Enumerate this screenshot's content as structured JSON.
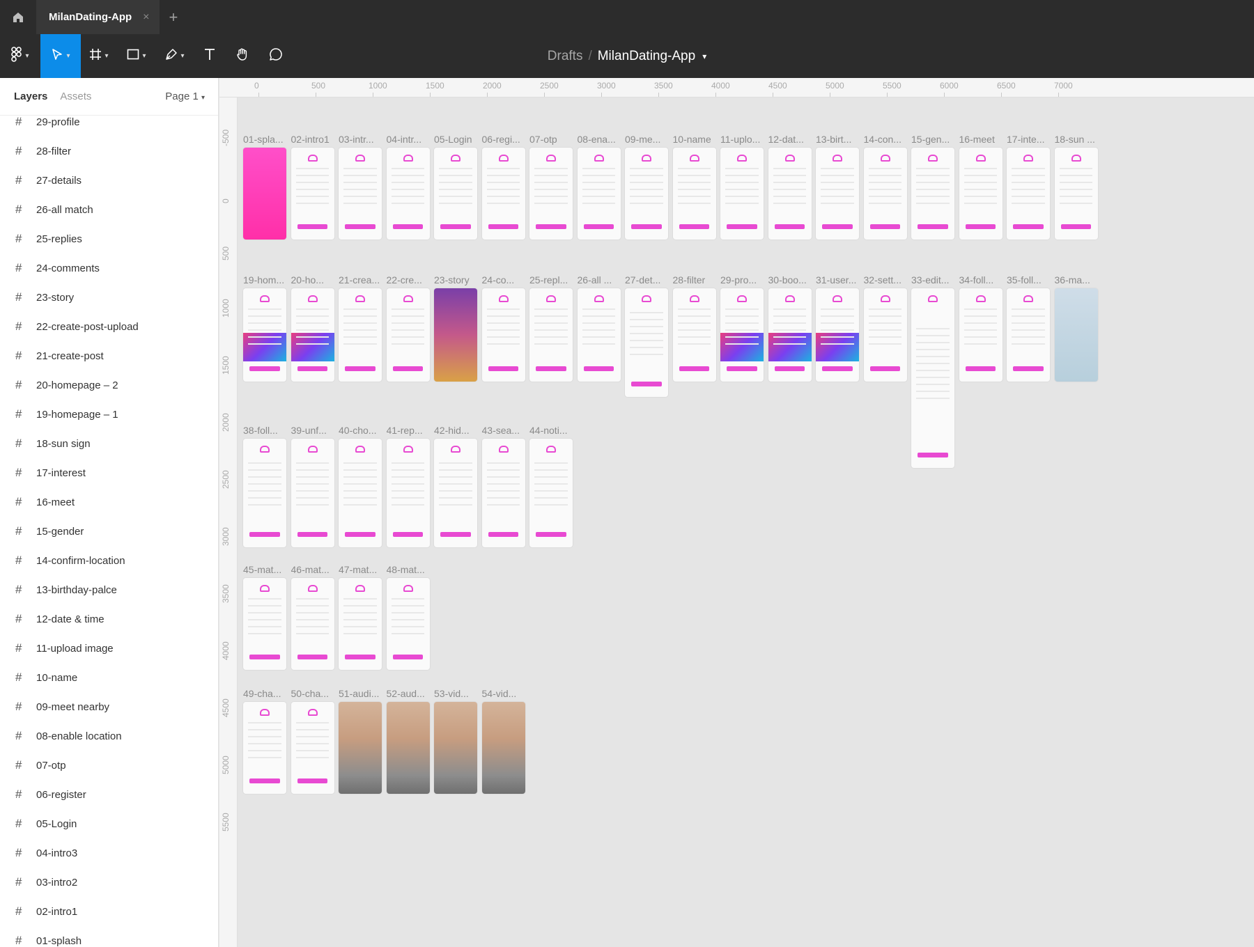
{
  "titlebar": {
    "tab_title": "MilanDating-App",
    "tab_close": "×",
    "new_tab": "+"
  },
  "toolbar": {
    "breadcrumb_drafts": "Drafts",
    "breadcrumb_sep": "/",
    "breadcrumb_file": "MilanDating-App",
    "tools": [
      "main-menu-icon",
      "move-icon",
      "frame-icon",
      "shape-icon",
      "pen-icon",
      "text-icon",
      "hand-icon",
      "comment-icon"
    ]
  },
  "sidebar": {
    "tab_layers": "Layers",
    "tab_assets": "Assets",
    "page": "Page 1",
    "layers": [
      "29-profile",
      "28-filter",
      "27-details",
      "26-all match",
      "25-replies",
      "24-comments",
      "23-story",
      "22-create-post-upload",
      "21-create-post",
      "20-homepage – 2",
      "19-homepage – 1",
      "18-sun sign",
      "17-interest",
      "16-meet",
      "15-gender",
      "14-confirm-location",
      "13-birthday-palce",
      "12-date & time",
      "11-upload image",
      "10-name",
      "09-meet nearby",
      "08-enable location",
      "07-otp",
      "06-register",
      "05-Login",
      "04-intro3",
      "03-intro2",
      "02-intro1",
      "01-splash"
    ]
  },
  "rulers": {
    "x_labels": [
      "0",
      "500",
      "1000",
      "1500",
      "2000",
      "2500",
      "3000",
      "3500",
      "4000",
      "4500",
      "5000",
      "5500",
      "6000",
      "6500",
      "7000"
    ],
    "y_labels": [
      "-500",
      "0",
      "500",
      "1000",
      "1500",
      "2000",
      "2500",
      "3000",
      "3500",
      "4000",
      "4500",
      "5000",
      "5500"
    ]
  },
  "frames": {
    "row1": [
      "01-spla...",
      "02-intro1",
      "03-intr...",
      "04-intr...",
      "05-Login",
      "06-regi...",
      "07-otp",
      "08-ena...",
      "09-me...",
      "10-name",
      "11-uplo...",
      "12-dat...",
      "13-birt...",
      "14-con...",
      "15-gen...",
      "16-meet",
      "17-inte...",
      "18-sun ..."
    ],
    "row2": [
      "19-hom...",
      "20-ho...",
      "21-crea...",
      "22-cre...",
      "23-story",
      "24-co...",
      "25-repl...",
      "26-all ...",
      "27-det...",
      "28-filter",
      "29-pro...",
      "30-boo...",
      "31-user...",
      "32-sett...",
      "33-edit...",
      "34-foll...",
      "35-foll...",
      "36-ma..."
    ],
    "row3": [
      "38-foll...",
      "39-unf...",
      "40-cho...",
      "41-rep...",
      "42-hid...",
      "43-sea...",
      "44-noti..."
    ],
    "row4": [
      "45-mat...",
      "46-mat...",
      "47-mat...",
      "48-mat..."
    ],
    "row5": [
      "49-cha...",
      "50-cha...",
      "51-audi...",
      "52-aud...",
      "53-vid...",
      "54-vid..."
    ]
  },
  "colors": {
    "accent": "#e84ad2",
    "toolbar_bg": "#2c2c2c",
    "active_tool": "#0c8ce9",
    "canvas_bg": "#e5e5e5"
  }
}
